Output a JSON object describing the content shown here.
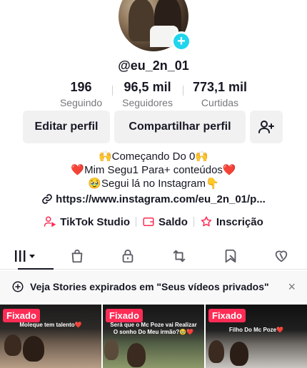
{
  "profile": {
    "username": "@eu_2n_01",
    "stats": [
      {
        "value": "196",
        "label": "Seguindo"
      },
      {
        "value": "96,5 mil",
        "label": "Seguidores"
      },
      {
        "value": "773,1 mil",
        "label": "Curtidas"
      }
    ],
    "bio": {
      "line1": "🙌Começando Do 0🙌",
      "line2": "❤️Mim Segu1 Para+ conteúdos❤️",
      "line3": "🥹Segui lá no Instagram👇"
    },
    "link": "https://www.instagram.com/eu_2n_01/p..."
  },
  "actions": {
    "edit_label": "Editar perfil",
    "share_label": "Compartilhar perfil"
  },
  "tools": {
    "studio_label": "TikTok Studio",
    "balance_label": "Saldo",
    "subscription_label": "Inscrição"
  },
  "banner": {
    "text": "Veja Stories expirados em \"Seus vídeos privados\"",
    "close": "×"
  },
  "videos": [
    {
      "pin": "Fixado",
      "caption": "Moleque tem talento❤️"
    },
    {
      "pin": "Fixado",
      "caption_line1": "Será que o Mc Poze vai Realizar",
      "caption_line2": "O sonho Do Meu irmão?🥹❤️"
    },
    {
      "pin": "Fixado",
      "caption": "Filho Do Mc Poze❤️"
    }
  ],
  "colors": {
    "accent": "#fe2c55",
    "badge": "#20d5ec",
    "text": "#161823",
    "muted": "#75777d",
    "button_bg": "#f1f1f2"
  }
}
